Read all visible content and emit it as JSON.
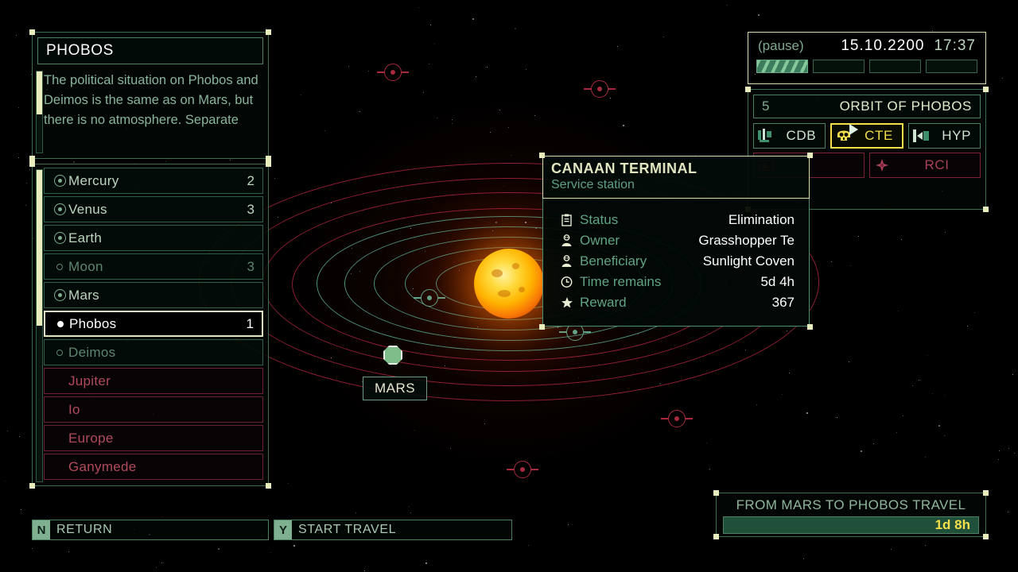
{
  "description_panel": {
    "title": "PHOBOS",
    "body": "The political situation on Phobos and Deimos is the same as on Mars, but there is no atmosphere. Separate"
  },
  "body_list": [
    {
      "name": "Mercury",
      "count": "2",
      "kind": "planet",
      "icon": "planet-icon",
      "selected": false
    },
    {
      "name": "Venus",
      "count": "3",
      "kind": "planet",
      "icon": "planet-icon",
      "selected": false
    },
    {
      "name": "Earth",
      "count": "",
      "kind": "planet",
      "icon": "planet-icon",
      "selected": false
    },
    {
      "name": "Moon",
      "count": "3",
      "kind": "moon",
      "icon": "moon-icon",
      "selected": false
    },
    {
      "name": "Mars",
      "count": "",
      "kind": "planet",
      "icon": "planet-icon",
      "selected": false
    },
    {
      "name": "Phobos",
      "count": "1",
      "kind": "moon",
      "icon": "moon-icon",
      "selected": true
    },
    {
      "name": "Deimos",
      "count": "",
      "kind": "moon",
      "icon": "moon-icon",
      "selected": false
    },
    {
      "name": "Jupiter",
      "count": "",
      "kind": "locked",
      "icon": "none",
      "selected": false
    },
    {
      "name": "Io",
      "count": "",
      "kind": "locked",
      "icon": "none",
      "selected": false
    },
    {
      "name": "Europe",
      "count": "",
      "kind": "locked",
      "icon": "none",
      "selected": false
    },
    {
      "name": "Ganymede",
      "count": "",
      "kind": "locked",
      "icon": "none",
      "selected": false
    }
  ],
  "hotkeys": [
    {
      "key": "N",
      "label": "RETURN"
    },
    {
      "key": "Y",
      "label": "START TRAVEL"
    }
  ],
  "terminal": {
    "title": "CANAAN TERMINAL",
    "subtitle": "Service station",
    "rows": [
      {
        "icon": "clipboard-icon",
        "label": "Status",
        "value": "Elimination"
      },
      {
        "icon": "person-icon",
        "label": "Owner",
        "value": "Grasshopper Te"
      },
      {
        "icon": "person-icon",
        "label": "Beneficiary",
        "value": "Sunlight Coven"
      },
      {
        "icon": "clock-icon",
        "label": "Time remains",
        "value": "5d 4h"
      },
      {
        "icon": "star-icon",
        "label": "Reward",
        "value": "367"
      }
    ]
  },
  "clock": {
    "pause_label": "(pause)",
    "date": "15.10.2200",
    "time": "17:37",
    "speed_segments": [
      true,
      false,
      false,
      false
    ]
  },
  "orbit_panel": {
    "number": "5",
    "name": "ORBIT OF PHOBOS",
    "factions_row1": [
      {
        "label": "CDB",
        "icon": "cdb-emblem-icon",
        "state": "normal"
      },
      {
        "label": "CTE",
        "icon": "skull-emblem-icon",
        "state": "active"
      },
      {
        "label": "HYP",
        "icon": "hyp-emblem-icon",
        "state": "normal"
      }
    ],
    "factions_row2": [
      {
        "label": "",
        "icon": "hidden-emblem-icon",
        "state": "red"
      },
      {
        "label": "RCI",
        "icon": "rci-emblem-icon",
        "state": "red"
      }
    ]
  },
  "travel": {
    "label": "FROM MARS TO PHOBOS TRAVEL",
    "duration": "1d 8h"
  },
  "map": {
    "mars_label": "MARS",
    "sun_name": "sun",
    "colors": {
      "teal_orbit": "#4e8f7a",
      "red_orbit": "#8e1f33",
      "accent_yellow": "#f2df4a",
      "frame_green": "#3c6b52",
      "marker_green": "#7fbd8b"
    }
  }
}
